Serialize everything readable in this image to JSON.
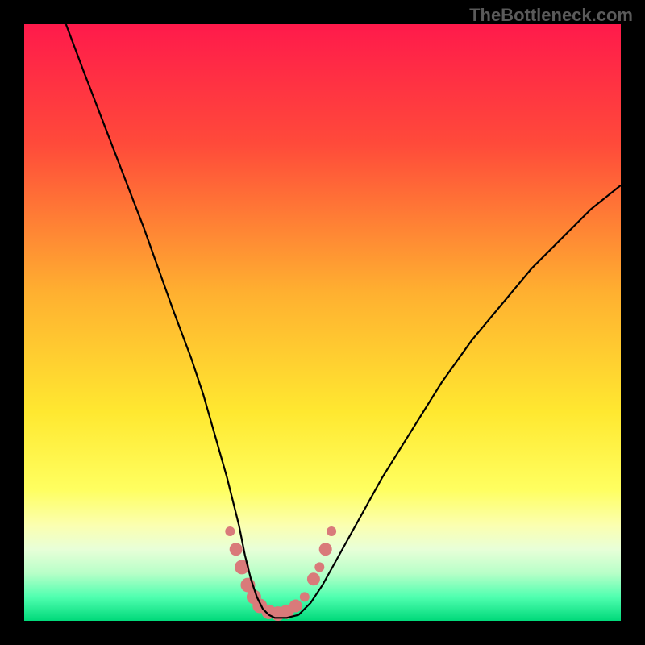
{
  "watermark": "TheBottleneck.com",
  "chart_data": {
    "type": "line",
    "title": "",
    "xlabel": "",
    "ylabel": "",
    "xlim": [
      0,
      100
    ],
    "ylim": [
      0,
      100
    ],
    "gradient_stops": [
      {
        "offset": 0,
        "color": "#ff1a4b"
      },
      {
        "offset": 20,
        "color": "#ff4a3a"
      },
      {
        "offset": 45,
        "color": "#ffb030"
      },
      {
        "offset": 65,
        "color": "#ffe830"
      },
      {
        "offset": 78,
        "color": "#ffff60"
      },
      {
        "offset": 84,
        "color": "#fbffb0"
      },
      {
        "offset": 88,
        "color": "#e8ffd8"
      },
      {
        "offset": 92,
        "color": "#b8ffc8"
      },
      {
        "offset": 96,
        "color": "#50ffb0"
      },
      {
        "offset": 100,
        "color": "#00d97a"
      }
    ],
    "series": [
      {
        "name": "curve",
        "stroke": "#000000",
        "x": [
          7,
          10,
          15,
          20,
          25,
          28,
          30,
          32,
          34,
          36,
          37,
          38,
          39,
          40,
          41,
          42,
          44,
          46,
          48,
          50,
          55,
          60,
          65,
          70,
          75,
          80,
          85,
          90,
          95,
          100
        ],
        "y": [
          100,
          92,
          79,
          66,
          52,
          44,
          38,
          31,
          24,
          16,
          11,
          7,
          4,
          2,
          1,
          0.5,
          0.5,
          1,
          3,
          6,
          15,
          24,
          32,
          40,
          47,
          53,
          59,
          64,
          69,
          73
        ]
      }
    ],
    "markers": {
      "color": "#d97a7a",
      "points": [
        {
          "x": 34.5,
          "y": 15,
          "r": 6
        },
        {
          "x": 35.5,
          "y": 12,
          "r": 8
        },
        {
          "x": 36.5,
          "y": 9,
          "r": 9
        },
        {
          "x": 37.5,
          "y": 6,
          "r": 9
        },
        {
          "x": 38.5,
          "y": 4,
          "r": 9
        },
        {
          "x": 39.5,
          "y": 2.5,
          "r": 9
        },
        {
          "x": 41,
          "y": 1.5,
          "r": 9
        },
        {
          "x": 42.5,
          "y": 1.2,
          "r": 9
        },
        {
          "x": 44,
          "y": 1.5,
          "r": 9
        },
        {
          "x": 45.5,
          "y": 2.5,
          "r": 8
        },
        {
          "x": 47,
          "y": 4,
          "r": 6
        },
        {
          "x": 48.5,
          "y": 7,
          "r": 8
        },
        {
          "x": 49.5,
          "y": 9,
          "r": 6
        },
        {
          "x": 50.5,
          "y": 12,
          "r": 8
        },
        {
          "x": 51.5,
          "y": 15,
          "r": 6
        }
      ]
    }
  }
}
